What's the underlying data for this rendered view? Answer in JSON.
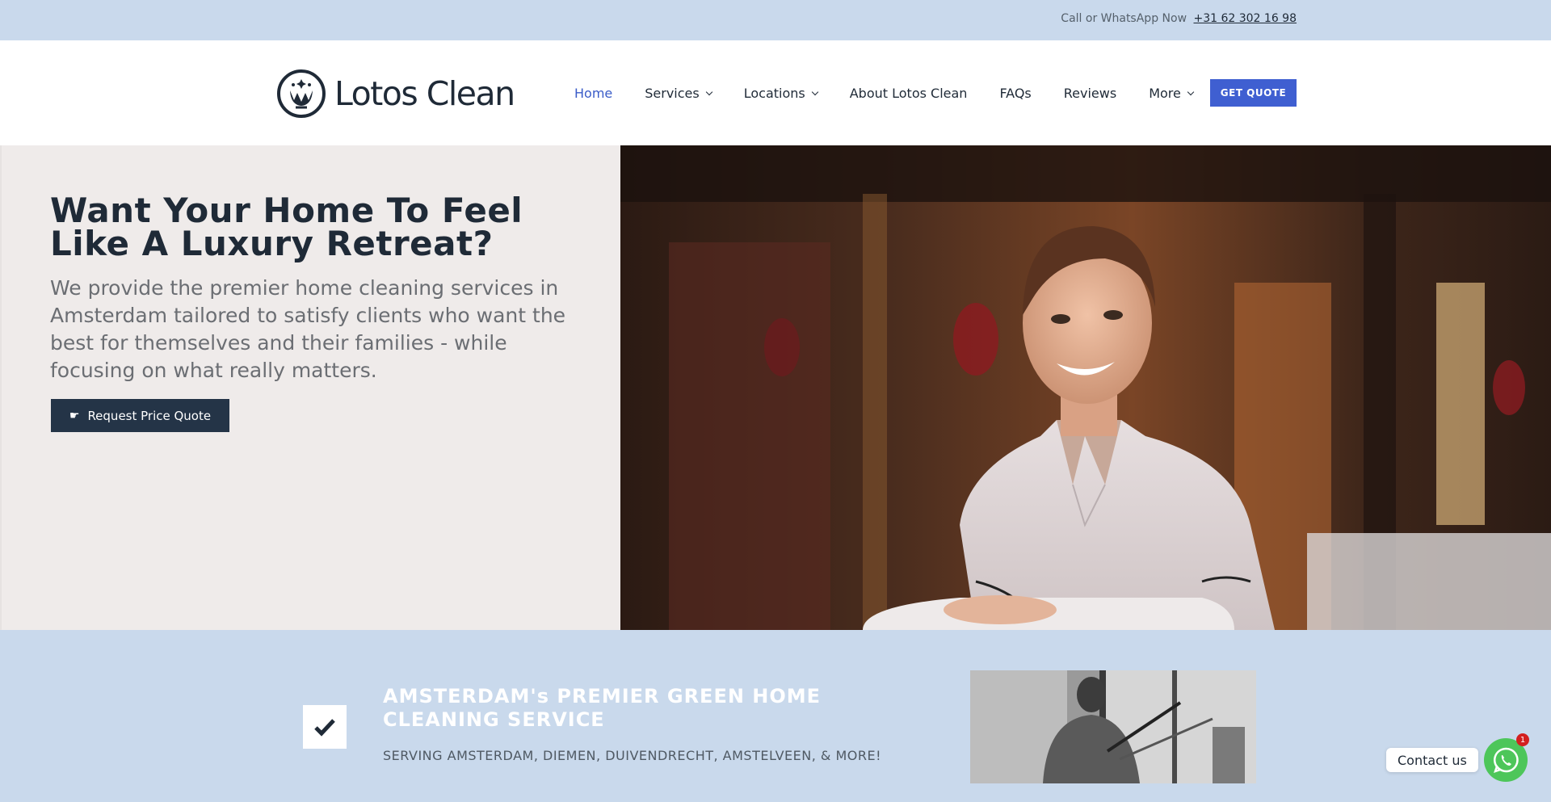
{
  "topbar": {
    "call_text": "Call or WhatsApp Now",
    "phone": "+31 62 302 16 98"
  },
  "header": {
    "logo_text": "Lotos Clean",
    "nav": [
      {
        "label": "Home",
        "active": true,
        "dropdown": false
      },
      {
        "label": "Services",
        "active": false,
        "dropdown": true
      },
      {
        "label": "Locations",
        "active": false,
        "dropdown": true
      },
      {
        "label": "About Lotos Clean",
        "active": false,
        "dropdown": false
      },
      {
        "label": "FAQs",
        "active": false,
        "dropdown": false
      },
      {
        "label": "Reviews",
        "active": false,
        "dropdown": false
      },
      {
        "label": "More",
        "active": false,
        "dropdown": true
      }
    ],
    "cta_label": "GET QUOTE"
  },
  "hero": {
    "title": "Want Your Home To Feel Like A Luxury Retreat?",
    "text": "We provide the premier home cleaning services in Amsterdam tailored to satisfy clients who want the best for themselves and their families - while focusing on what really matters.",
    "button_label": "Request Price Quote"
  },
  "band": {
    "title": "AMSTERDAM's PREMIER GREEN HOME CLEANING SERVICE",
    "subtitle": "SERVING AMSTERDAM, DIEMEN, DUIVENDRECHT, AMSTELVEEN, & MORE!"
  },
  "contact": {
    "label": "Contact us",
    "badge": "1"
  },
  "colors": {
    "topbar_bg": "#c9d9ec",
    "accent": "#3f5fd1",
    "dark_button": "#243447",
    "whatsapp": "#4dc65a"
  }
}
